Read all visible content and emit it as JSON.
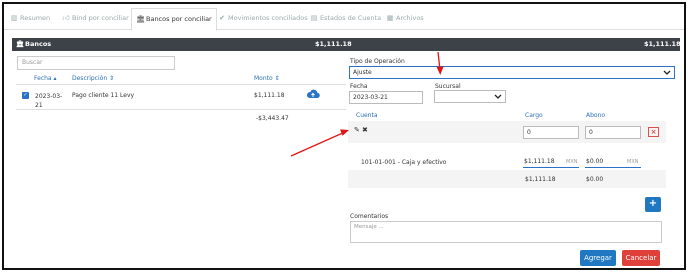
{
  "tabs": [
    {
      "icon": "bar-chart-icon",
      "label": "Resumen"
    },
    {
      "icon": "thumbs-up-icon",
      "label": "Bind por conciliar"
    },
    {
      "icon": "bank-icon",
      "label": "Bancos por conciliar"
    },
    {
      "icon": "check-icon",
      "label": "Movimientos conciliados"
    },
    {
      "icon": "document-icon",
      "label": "Estados de Cuenta"
    },
    {
      "icon": "archive-icon",
      "label": "Archivos"
    }
  ],
  "header": {
    "title": "Bancos",
    "left_amount": "$1,111.18",
    "right_amount": "$1,111.18"
  },
  "left": {
    "search_placeholder": "Buscar",
    "columns": {
      "fecha": "Fecha",
      "descripcion": "Descripción",
      "monto": "Monto"
    },
    "row": {
      "fecha": "2023-03-21",
      "descripcion": "Pago cliente 11 Levy",
      "monto": "$1,111.18",
      "saldo": "-$3,443.47"
    }
  },
  "form": {
    "tipo_label": "Tipo de Operación",
    "tipo_value": "Ajuste",
    "fecha_label": "Fecha",
    "fecha_value": "2023-03-21",
    "sucursal_label": "Sucursal",
    "sucursal_value": "",
    "cols": {
      "cuenta": "Cuenta",
      "cargo": "Cargo",
      "abono": "Abono"
    },
    "cargo_value": "0",
    "abono_value": "0",
    "entry": {
      "cuenta": "101-01-001 - Caja y efectivo",
      "cargo": "$1,111.18",
      "cargo_unit": "MXN",
      "abono": "$0.00",
      "abono_unit": "MXN"
    },
    "totals": {
      "cargo": "$1,111.18",
      "abono": "$0.00"
    },
    "comentarios_label": "Comentarios",
    "comentarios_placeholder": "Mensaje ...",
    "agregar": "Agregar",
    "cancelar": "Cancelar"
  },
  "colors": {
    "accent": "#2a72c8",
    "bar": "#3d4248",
    "agregar": "#1f78c1",
    "cancelar": "#e0403a",
    "arrow": "#e01515"
  }
}
